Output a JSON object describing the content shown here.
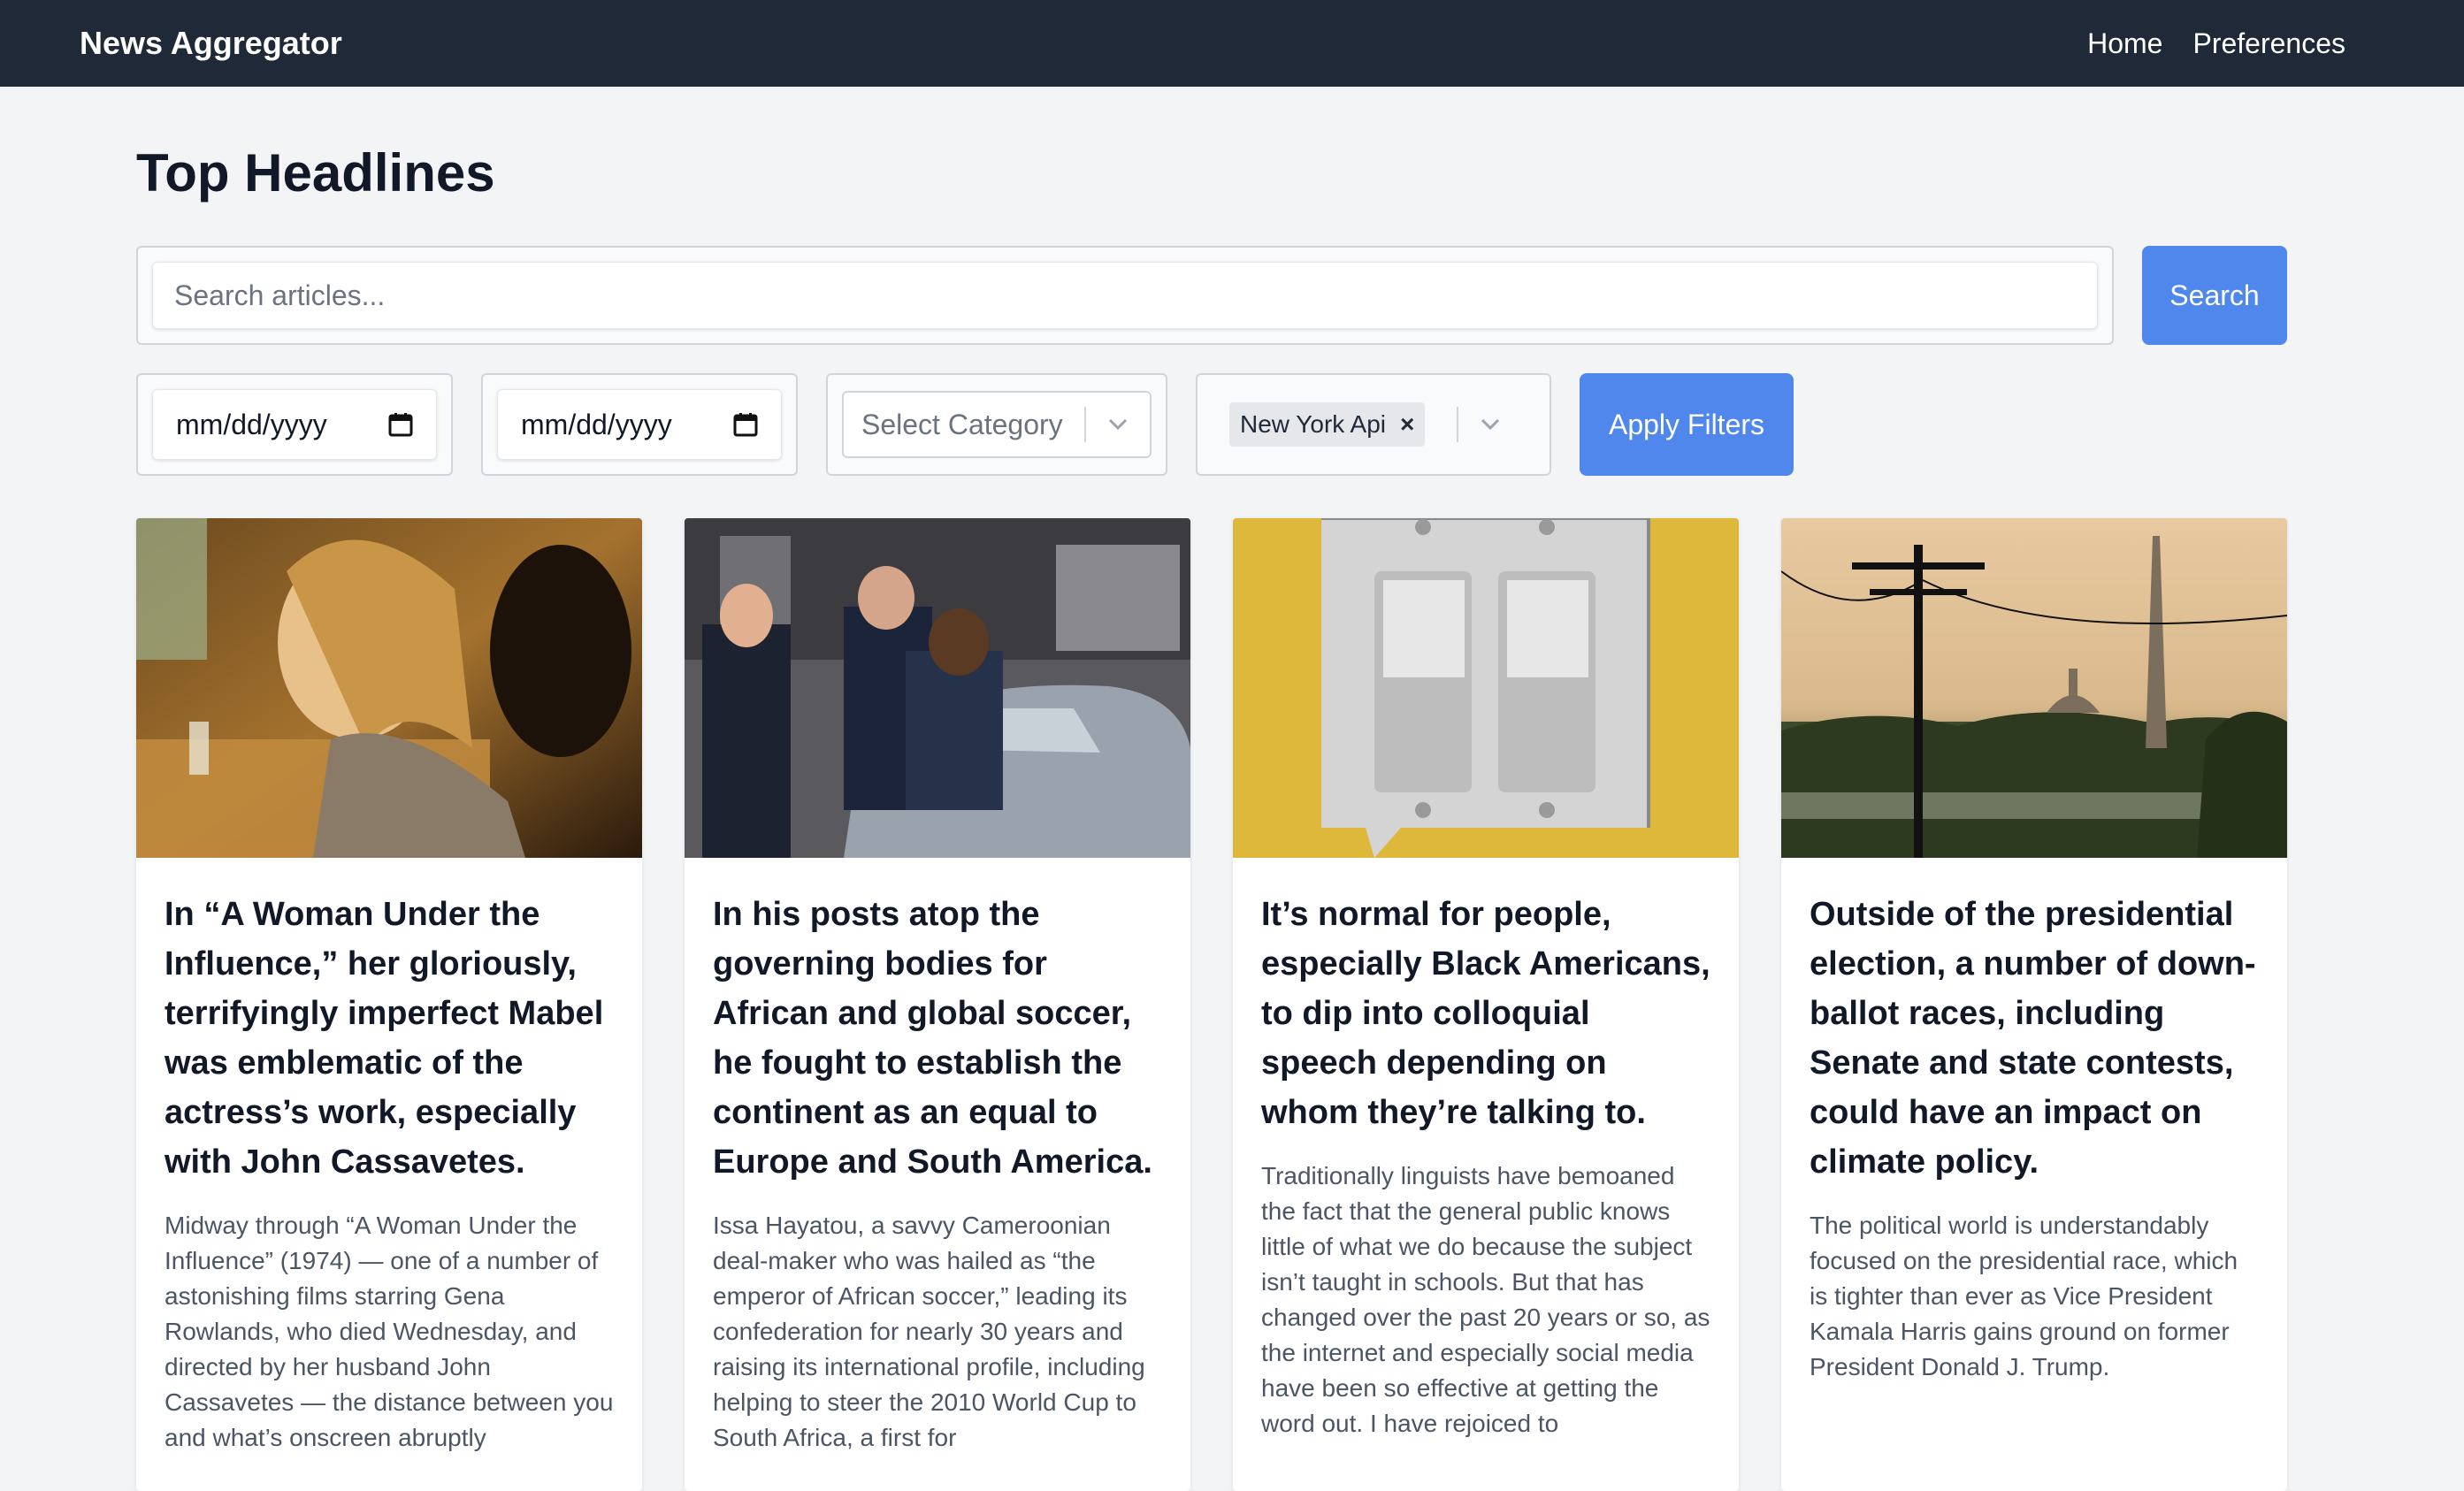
{
  "nav": {
    "brand": "News Aggregator",
    "home": "Home",
    "preferences": "Preferences"
  },
  "page": {
    "title": "Top Headlines"
  },
  "search": {
    "placeholder": "Search articles...",
    "button": "Search"
  },
  "filters": {
    "from_date": "mm/dd/yyyy",
    "to_date": "mm/dd/yyyy",
    "category_placeholder": "Select Category",
    "source_chip": "New York Api",
    "chip_remove": "×",
    "apply": "Apply Filters"
  },
  "articles": [
    {
      "title": "In “A Woman Under the Influence,” her gloriously, terrifyingly imperfect Mabel was emblematic of the actress’s work, especially with John Cassavetes.",
      "description": "Midway through “A Woman Under the Influence” (1974) — one of a number of astonishing films starring Gena Rowlands, who died Wednesday, and directed by her husband John Cassavetes — the distance between you and what’s onscreen abruptly"
    },
    {
      "title": "In his posts atop the governing bodies for African and global soccer, he fought to establish the continent as an equal to Europe and South America.",
      "description": "Issa Hayatou, a savvy Cameroonian deal-maker who was hailed as “the emperor of African soccer,” leading its confederation for nearly 30 years and raising its international profile, including helping to steer the 2010 World Cup to South Africa, a first for"
    },
    {
      "title": "It’s normal for people, especially Black Americans, to dip into colloquial speech depending on whom they’re talking to.",
      "description": "Traditionally linguists have bemoaned the fact that the general public knows little of what we do because the subject isn’t taught in schools. But that has changed over the past 20 years or so, as the internet and especially social media have been so effective at getting the word out. I have rejoiced to"
    },
    {
      "title": "Outside of the presidential election, a number of down-ballot races, including Senate and state contests, could have an impact on climate policy.",
      "description": "The political world is understandably focused on the presidential race, which is tighter than ever as Vice President Kamala Harris gains ground on former President Donald J. Trump."
    }
  ]
}
